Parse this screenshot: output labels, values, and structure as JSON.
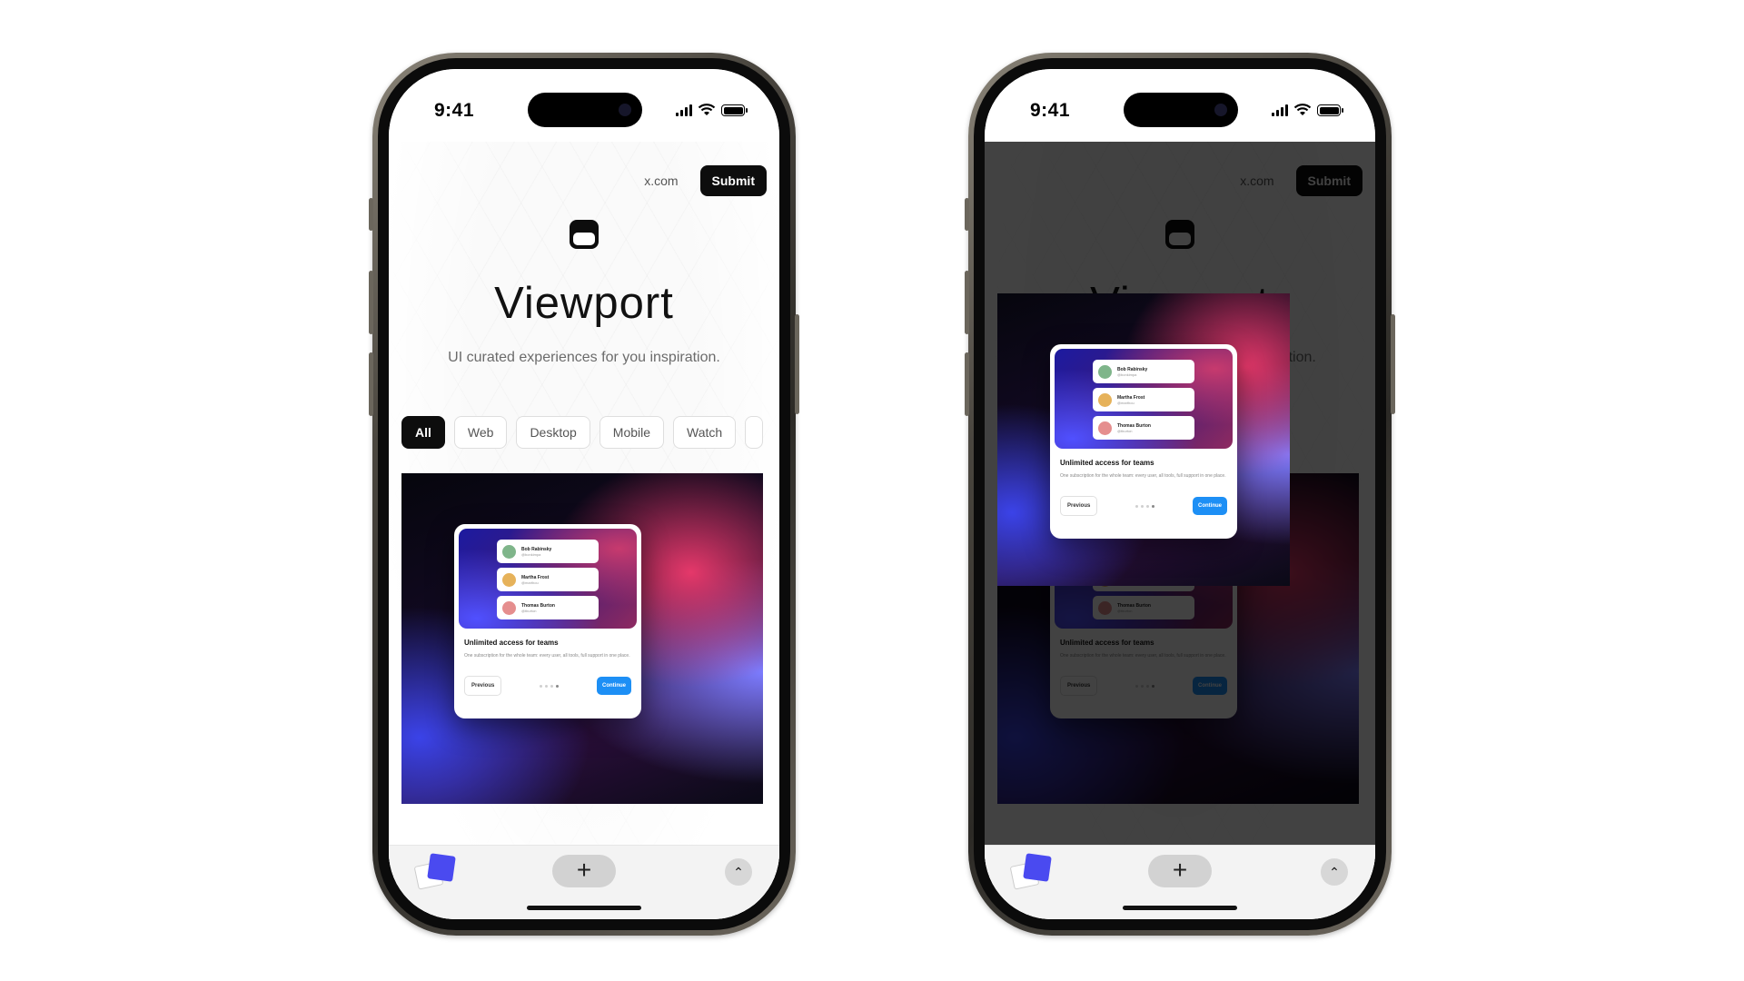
{
  "status": {
    "time": "9:41"
  },
  "nav": {
    "link": "x.com",
    "submit": "Submit"
  },
  "hero": {
    "title": "Viewport",
    "subtitle": "UI curated experiences for you inspiration."
  },
  "filters": [
    "All",
    "Web",
    "Desktop",
    "Mobile",
    "Watch"
  ],
  "modal": {
    "users": [
      {
        "name": "Bob Rabinsky",
        "handle": "@bonkimpa",
        "avatar_color": "#7fb58a"
      },
      {
        "name": "Martha Frost",
        "handle": "@marthou",
        "avatar_color": "#e6b25a"
      },
      {
        "name": "Thomas Burton",
        "handle": "@tburton",
        "avatar_color": "#e58e8e"
      }
    ],
    "title": "Unlimited access for teams",
    "description": "One subscription for the whole team: every user, all tools, full support in one place.",
    "previous": "Previous",
    "continue": "Continue"
  },
  "toolbar": {
    "plus": "+",
    "up": "^"
  },
  "colors": {
    "accent": "#1d8ff5",
    "dark": "#0d0d0d"
  }
}
